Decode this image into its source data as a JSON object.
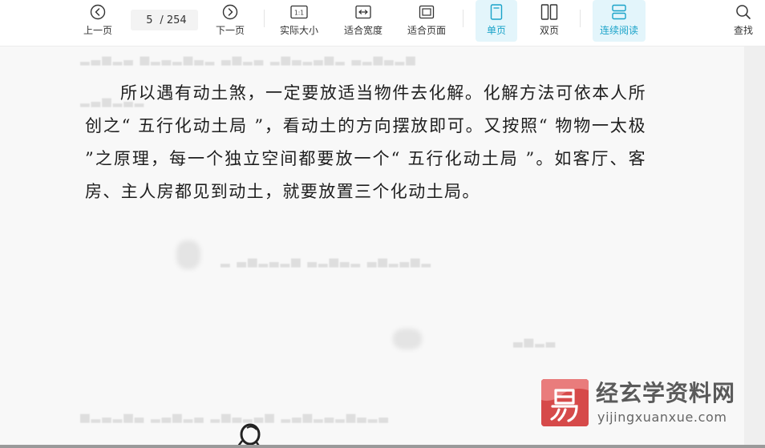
{
  "toolbar": {
    "prev_page": "上一页",
    "next_page": "下一页",
    "current_page": "5",
    "total_pages": "/ 254",
    "actual_size": "实际大小",
    "fit_width": "适合宽度",
    "fit_page": "适合页面",
    "single_page": "单页",
    "double_page": "双页",
    "continuous": "连续阅读",
    "search": "查找"
  },
  "icons": {
    "actual_size_glyph": "1:1"
  },
  "document": {
    "paragraph": "所以遇有动土煞，一定要放适当物件去化解。化解方法可依本人所创之“ 五行化动土局 ”，看动土的方向摆放即可。又按照“ 物物一太极 ”之原理，每一个独立空间都要放一个“ 五行化动土局 ”。如客厅、客房、主人房都见到动土，就要放置三个化动土局。"
  },
  "watermark": {
    "site_name": "经玄学资料网",
    "url": "yijingxuanxue.com"
  },
  "colors": {
    "accent": "#1aa3c9",
    "active_bg": "#e3f5fb",
    "logo_red": "#d64a4a"
  }
}
